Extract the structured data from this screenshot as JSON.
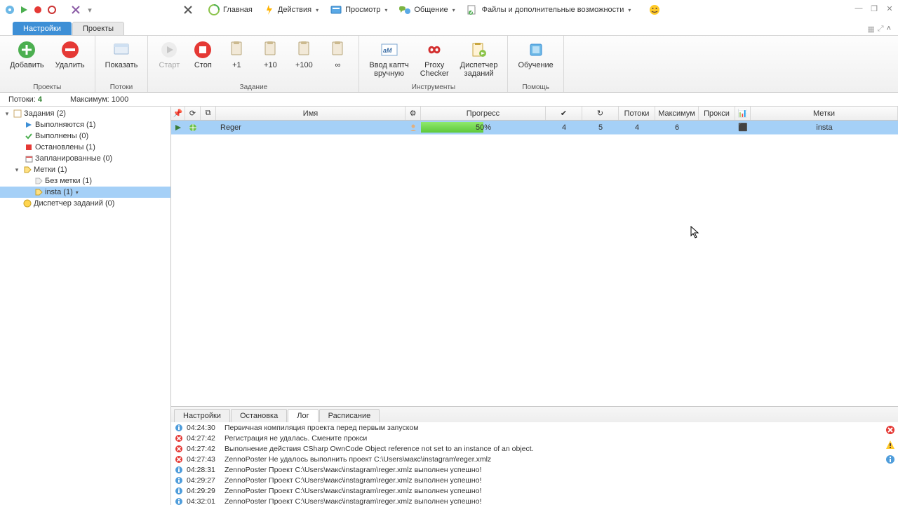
{
  "menu": {
    "home": "Главная",
    "actions": "Действия",
    "view": "Просмотр",
    "chat": "Общение",
    "files": "Файлы и дополнительные возможности"
  },
  "context_tabs": {
    "settings": "Настройки",
    "projects": "Проекты"
  },
  "ribbon": {
    "groups": {
      "projects": "Проекты",
      "threads": "Потоки",
      "task": "Задание",
      "tools": "Инструменты",
      "help": "Помощь"
    },
    "add": "Добавить",
    "delete": "Удалить",
    "show": "Показать",
    "start": "Старт",
    "stop": "Стоп",
    "p1": "+1",
    "p10": "+10",
    "p100": "+100",
    "pinf": "∞",
    "captcha": "Ввод каптч\nвручную",
    "proxy": "Proxy\nChecker",
    "dispatcher": "Диспетчер\nзаданий",
    "train": "Обучение"
  },
  "infobar": {
    "threads_lbl": "Потоки:",
    "threads": "4",
    "max_lbl": "Максимум:",
    "max": "1000"
  },
  "tree": {
    "tasks": "Задания (2)",
    "running": "Выполняются (1)",
    "done": "Выполнены (0)",
    "stopped": "Остановлены (1)",
    "scheduled": "Запланированные (0)",
    "labels": "Метки (1)",
    "nolabel": "Без метки (1)",
    "insta": "insta (1)",
    "dispatch": "Диспетчер заданий (0)"
  },
  "grid": {
    "headers": {
      "name": "Имя",
      "progress": "Прогресс",
      "threads": "Потоки",
      "max": "Максимум",
      "proxy": "Прокси",
      "labels": "Метки"
    },
    "row": {
      "name": "Reger",
      "progress": "50%",
      "progress_pct": 50,
      "done": "4",
      "repeat": "5",
      "threads": "4",
      "max": "6",
      "proxy": "",
      "label": "insta"
    }
  },
  "bottom_tabs": {
    "settings": "Настройки",
    "stop": "Остановка",
    "log": "Лог",
    "schedule": "Расписание"
  },
  "log": [
    {
      "t": "info",
      "time": "04:24:30",
      "msg": "Первичная компиляция проекта перед первым запуском"
    },
    {
      "t": "err",
      "time": "04:27:42",
      "msg": " Регистрация не удалась. Смените прокси"
    },
    {
      "t": "err",
      "time": "04:27:42",
      "msg": "Выполнение действия CSharp OwnCode Object reference not set to an instance of an object."
    },
    {
      "t": "err",
      "time": "04:27:43",
      "msg": "ZennoPoster Не удалось выполнить проект C:\\Users\\макс\\instagram\\reger.xmlz"
    },
    {
      "t": "info",
      "time": "04:28:31",
      "msg": "ZennoPoster Проект C:\\Users\\макс\\instagram\\reger.xmlz выполнен успешно!"
    },
    {
      "t": "info",
      "time": "04:29:27",
      "msg": "ZennoPoster Проект C:\\Users\\макс\\instagram\\reger.xmlz выполнен успешно!"
    },
    {
      "t": "info",
      "time": "04:29:29",
      "msg": "ZennoPoster Проект C:\\Users\\макс\\instagram\\reger.xmlz выполнен успешно!"
    },
    {
      "t": "info",
      "time": "04:32:01",
      "msg": "ZennoPoster Проект C:\\Users\\макс\\instagram\\reger.xmlz выполнен успешно!"
    }
  ]
}
